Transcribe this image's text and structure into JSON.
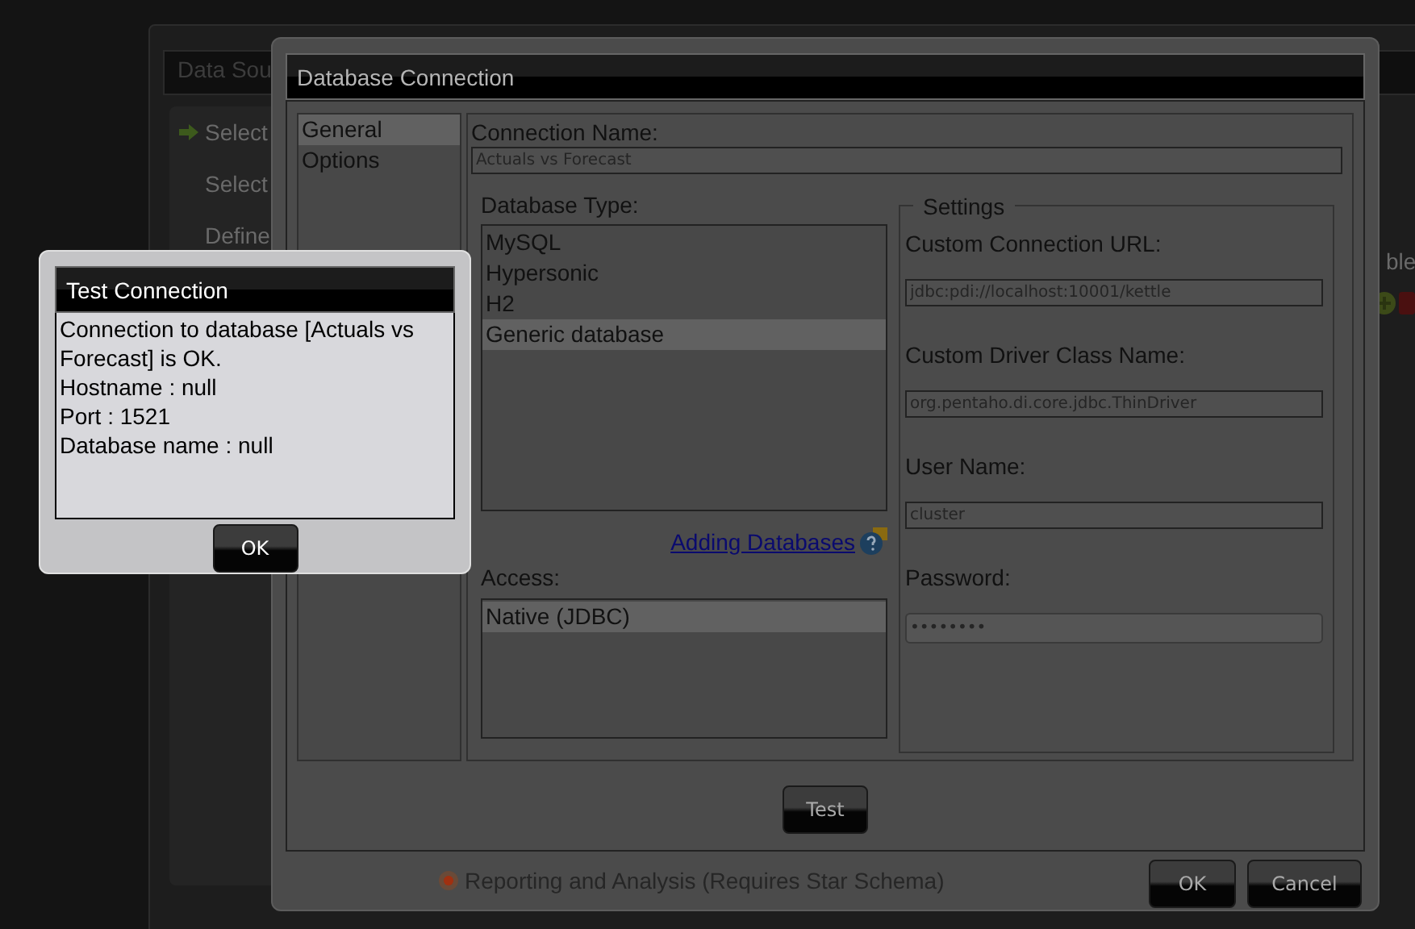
{
  "background_window": {
    "title": "Data Sou",
    "steps": [
      {
        "label": "Select",
        "current": true
      },
      {
        "label": "Select",
        "current": false
      },
      {
        "label": "Define",
        "current": false
      }
    ],
    "side_label": "ble",
    "radio": {
      "label": "Reporting and Analysis (Requires Star Schema)",
      "selected": true
    }
  },
  "dialog": {
    "title": "Database Connection",
    "sections": [
      {
        "label": "General",
        "selected": true
      },
      {
        "label": "Options",
        "selected": false
      }
    ],
    "connection_name": {
      "label": "Connection Name:",
      "value": "Actuals vs Forecast"
    },
    "database_type": {
      "label": "Database Type:",
      "items": [
        {
          "label": "MySQL",
          "selected": false
        },
        {
          "label": "Hypersonic",
          "selected": false
        },
        {
          "label": "H2",
          "selected": false
        },
        {
          "label": "Generic database",
          "selected": true
        }
      ]
    },
    "help_link": "Adding Databases",
    "access": {
      "label": "Access:",
      "items": [
        {
          "label": "Native (JDBC)",
          "selected": true
        }
      ]
    },
    "settings": {
      "title": "Settings",
      "fields": [
        {
          "label": "Custom Connection URL:",
          "value": "jdbc:pdi://localhost:10001/kettle",
          "kind": "text"
        },
        {
          "label": "Custom Driver Class Name:",
          "value": "org.pentaho.di.core.jdbc.ThinDriver",
          "kind": "text"
        },
        {
          "label": "User Name:",
          "value": "cluster",
          "kind": "text"
        },
        {
          "label": "Password:",
          "value": "••••••••",
          "kind": "password"
        }
      ]
    },
    "test_button": "Test",
    "buttons": [
      "OK",
      "Cancel"
    ]
  },
  "message_box": {
    "title": "Test Connection",
    "lines": [
      "Connection to database [Actuals vs Forecast] is OK.",
      "Hostname : null",
      "Port : 1521",
      "Database name : null"
    ],
    "button": "OK"
  }
}
